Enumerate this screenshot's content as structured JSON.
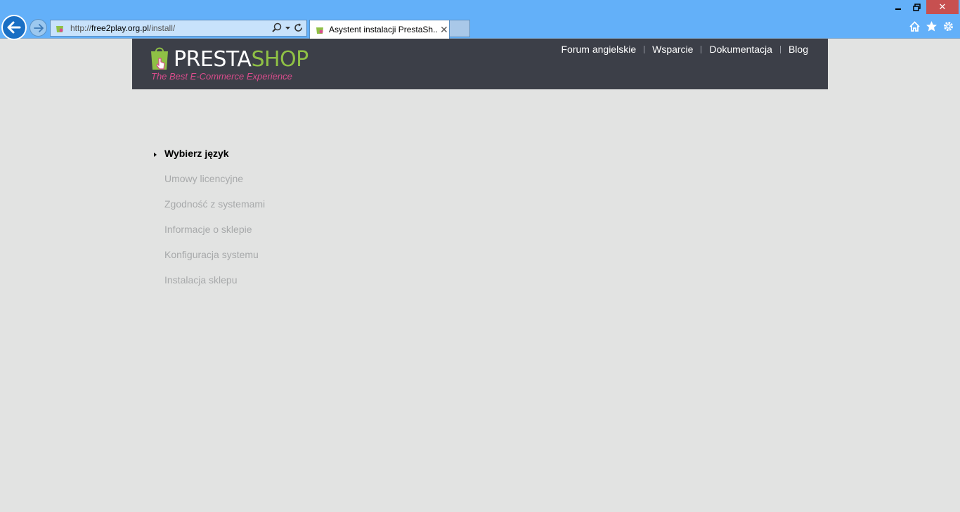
{
  "browser": {
    "url_prefix": "http://",
    "url_domain": "free2play.org.pl",
    "url_path": "/install/",
    "tab_title": "Asystent instalacji PrestaSh...",
    "tab_close": "✕",
    "window_close": "✕"
  },
  "header": {
    "logo_presta": "PRESTA",
    "logo_shop": "SHOP",
    "logo_tagline": "The Best E-Commerce Experience",
    "nav": [
      {
        "label": "Forum angielskie"
      },
      {
        "label": "Wsparcie"
      },
      {
        "label": "Dokumentacja"
      },
      {
        "label": "Blog"
      }
    ]
  },
  "steps": [
    {
      "label": "Wybierz język",
      "active": true
    },
    {
      "label": "Umowy licencyjne",
      "active": false
    },
    {
      "label": "Zgodność z systemami",
      "active": false
    },
    {
      "label": "Informacje o sklepie",
      "active": false
    },
    {
      "label": "Konfiguracja systemu",
      "active": false
    },
    {
      "label": "Instalacja sklepu",
      "active": false
    }
  ],
  "colors": {
    "chrome": "#63b0f9",
    "header_bg": "#3c3f48",
    "page_bg": "#e2e3e2",
    "accent_green": "#8fc045",
    "accent_pink": "#d94c8c"
  }
}
